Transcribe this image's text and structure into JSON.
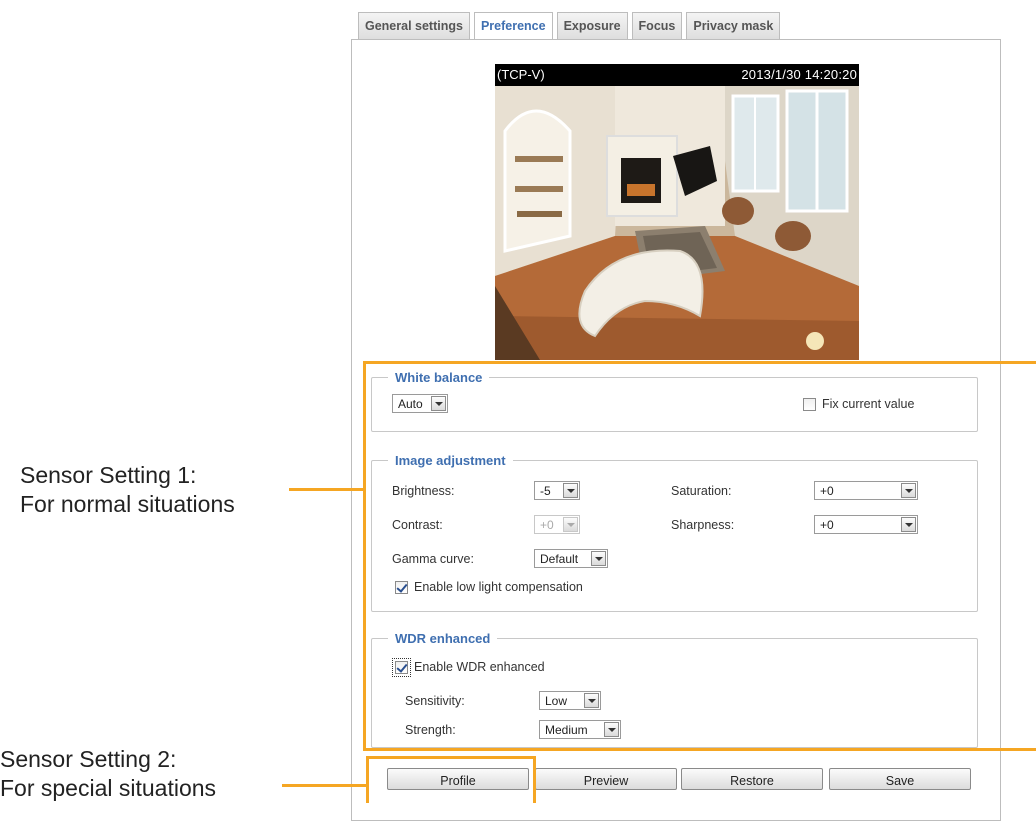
{
  "tabs": [
    {
      "label": "General settings",
      "active": false
    },
    {
      "label": "Preference",
      "active": true
    },
    {
      "label": "Exposure",
      "active": false
    },
    {
      "label": "Focus",
      "active": false
    },
    {
      "label": "Privacy mask",
      "active": false
    }
  ],
  "camera": {
    "label": "(TCP-V)",
    "timestamp": "2013/1/30 14:20:20"
  },
  "white_balance": {
    "legend": "White balance",
    "mode": "Auto",
    "fix_label": "Fix current value",
    "fix_checked": false
  },
  "image_adjustment": {
    "legend": "Image adjustment",
    "brightness_label": "Brightness:",
    "brightness": "-5",
    "saturation_label": "Saturation:",
    "saturation": "+0",
    "contrast_label": "Contrast:",
    "contrast": "+0",
    "sharpness_label": "Sharpness:",
    "sharpness": "+0",
    "gamma_label": "Gamma curve:",
    "gamma": "Default",
    "low_light_label": "Enable low light compensation",
    "low_light_checked": true
  },
  "wdr": {
    "legend": "WDR enhanced",
    "enable_label": "Enable WDR enhanced",
    "enable_checked": true,
    "sensitivity_label": "Sensitivity:",
    "sensitivity": "Low",
    "strength_label": "Strength:",
    "strength": "Medium"
  },
  "buttons": {
    "profile": "Profile",
    "preview": "Preview",
    "restore": "Restore",
    "save": "Save"
  },
  "annotations": {
    "setting1_line1": "Sensor Setting 1:",
    "setting1_line2": "For normal situations",
    "setting2_line1": "Sensor Setting 2:",
    "setting2_line2": "For special situations"
  },
  "colors": {
    "accent": "#3f6fb0",
    "highlight": "#f5a623"
  }
}
